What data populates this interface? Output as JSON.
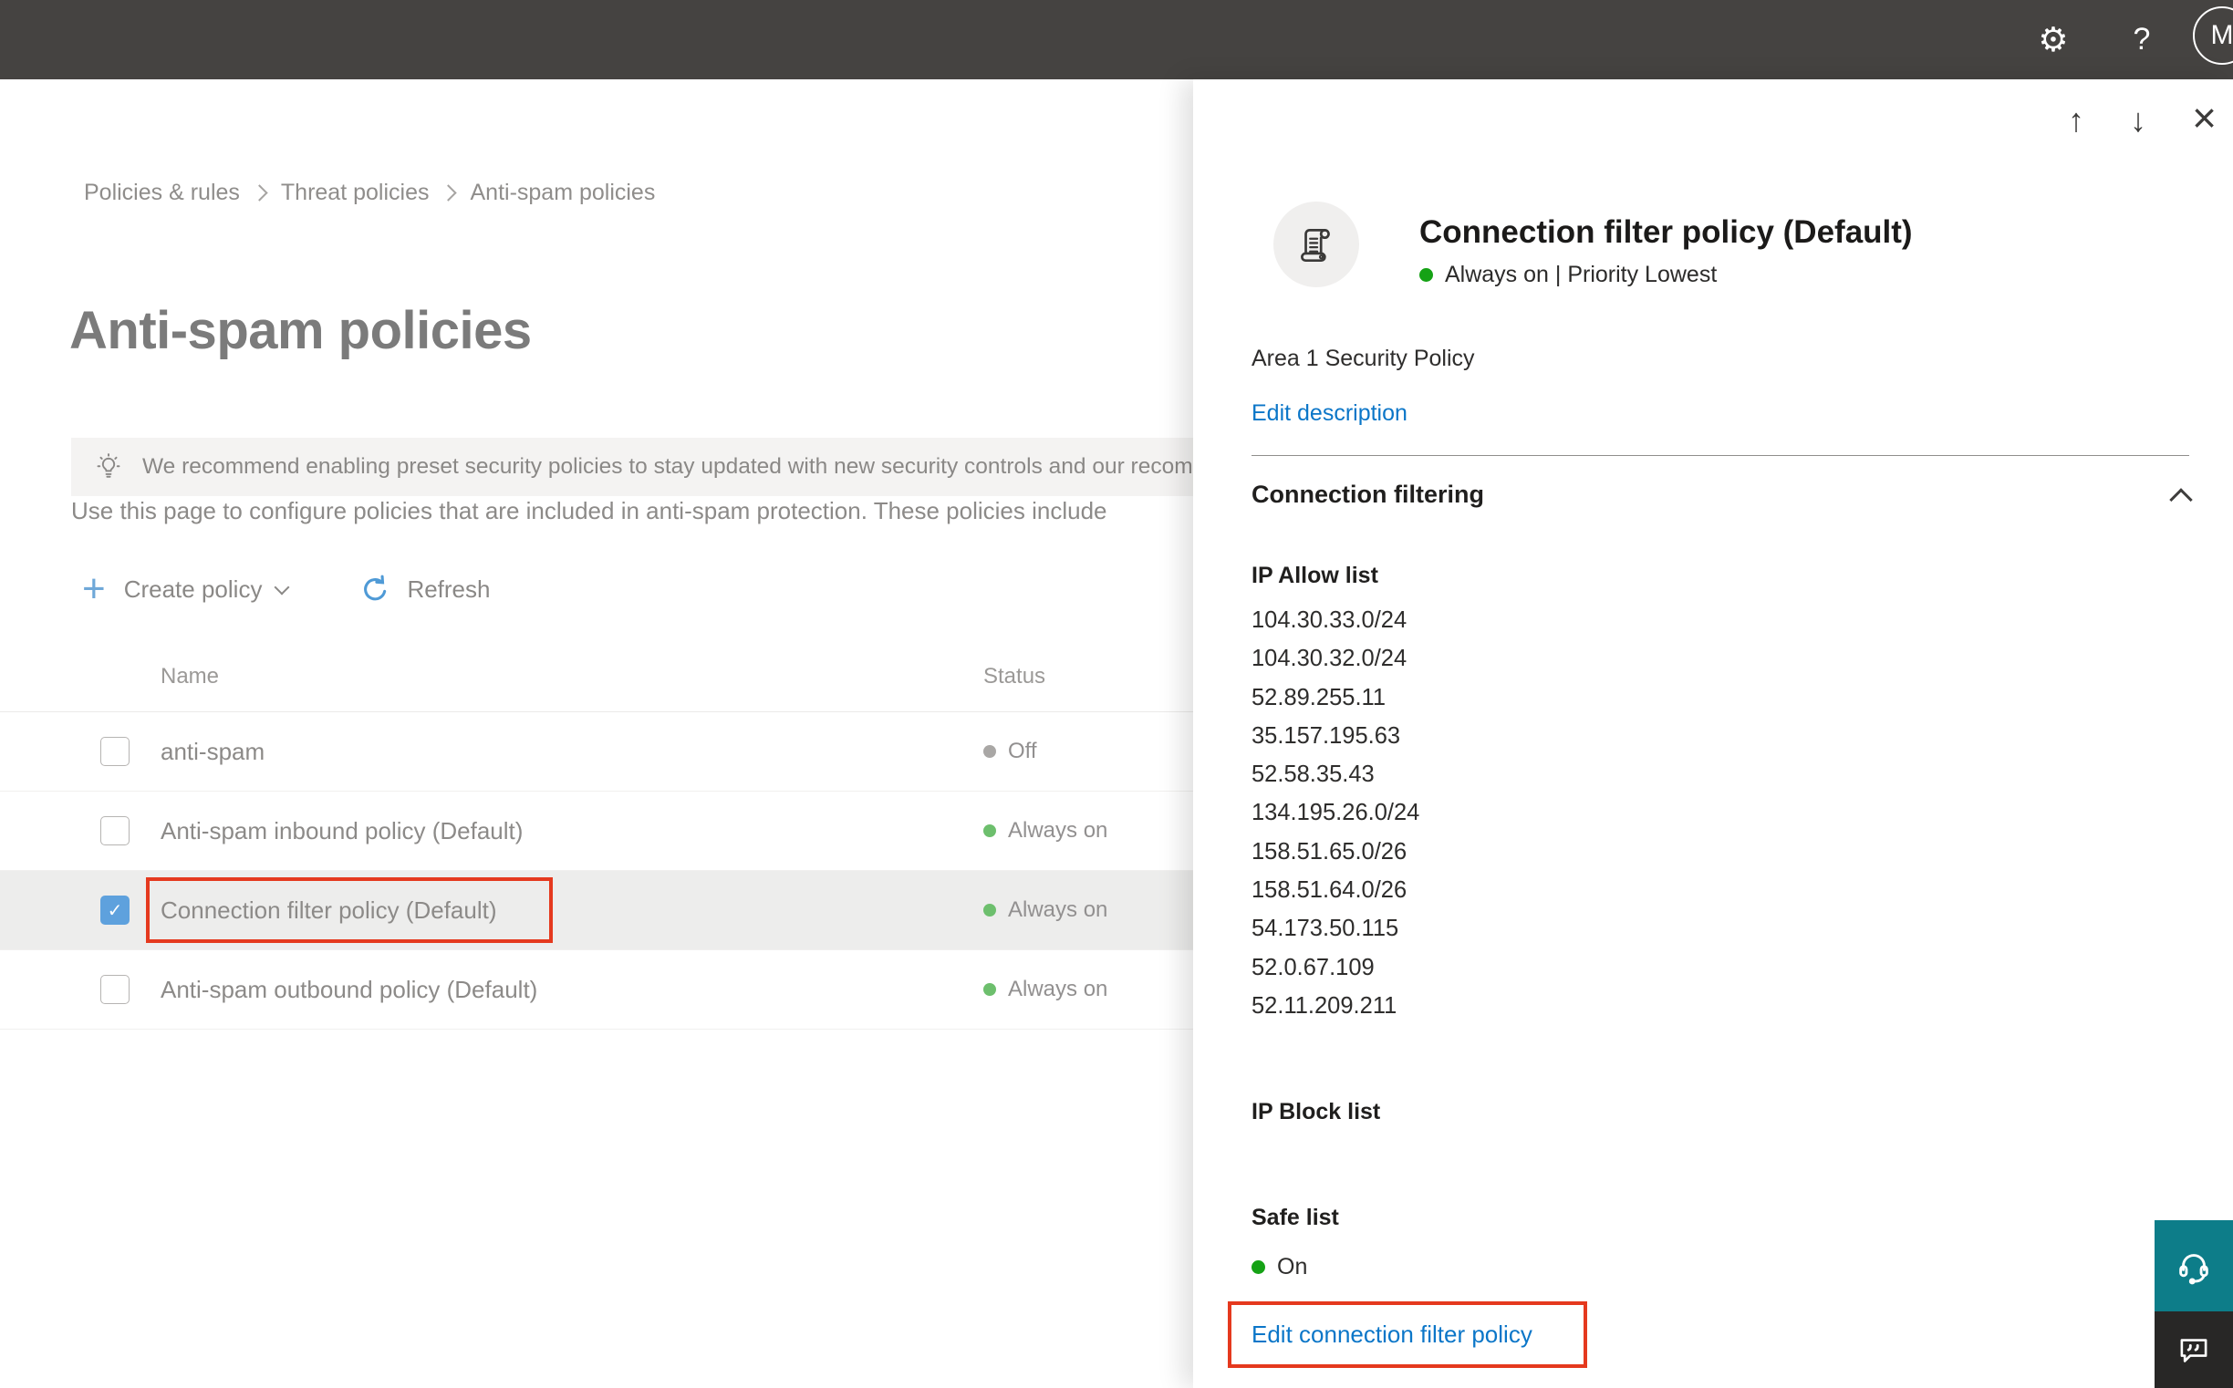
{
  "colors": {
    "topbar_bg": "#454341",
    "accent_blue": "#0b76c8",
    "annotation_red": "#e5391e",
    "status_green": "#6dbf6d",
    "status_green_bright": "#15a215",
    "status_gray": "#a9a7a5",
    "selected_row_bg": "#ededec",
    "banner_bg": "#f4f3f2",
    "support_teal": "#0d7d89",
    "feedback_dark": "#282726"
  },
  "icons": {
    "settings": "⚙",
    "help": "?",
    "avatar_initial": "M",
    "nav_up": "↑",
    "nav_down": "↓",
    "close": "×",
    "check": "✓"
  },
  "breadcrumb": {
    "items": [
      "Policies & rules",
      "Threat policies",
      "Anti-spam policies"
    ]
  },
  "page": {
    "title": "Anti-spam policies",
    "banner": "We recommend enabling preset security policies to stay updated with new security controls and our recomme",
    "intro": "Use this page to configure policies that are included in anti-spam protection. These policies include"
  },
  "toolbar": {
    "create": "Create policy",
    "refresh": "Refresh"
  },
  "table": {
    "headers": {
      "name": "Name",
      "status": "Status"
    },
    "rows": [
      {
        "name": "anti-spam",
        "status": "Off"
      },
      {
        "name": "Anti-spam inbound policy (Default)",
        "status": "Always on"
      },
      {
        "name": "Connection filter policy (Default)",
        "status": "Always on"
      },
      {
        "name": "Anti-spam outbound policy (Default)",
        "status": "Always on"
      }
    ]
  },
  "panel": {
    "title": "Connection filter policy (Default)",
    "status": "Always on | Priority Lowest",
    "description": "Area 1 Security Policy",
    "edit_description": "Edit description",
    "section": "Connection filtering",
    "ip_allow_label": "IP Allow list",
    "ip_allow": [
      "104.30.33.0/24",
      "104.30.32.0/24",
      "52.89.255.11",
      "35.157.195.63",
      "52.58.35.43",
      "134.195.26.0/24",
      "158.51.65.0/26",
      "158.51.64.0/26",
      "54.173.50.115",
      "52.0.67.109",
      "52.11.209.211"
    ],
    "ip_block_label": "IP Block list",
    "safe_list_label": "Safe list",
    "safe_list_status": "On",
    "edit_link": "Edit connection filter policy"
  }
}
